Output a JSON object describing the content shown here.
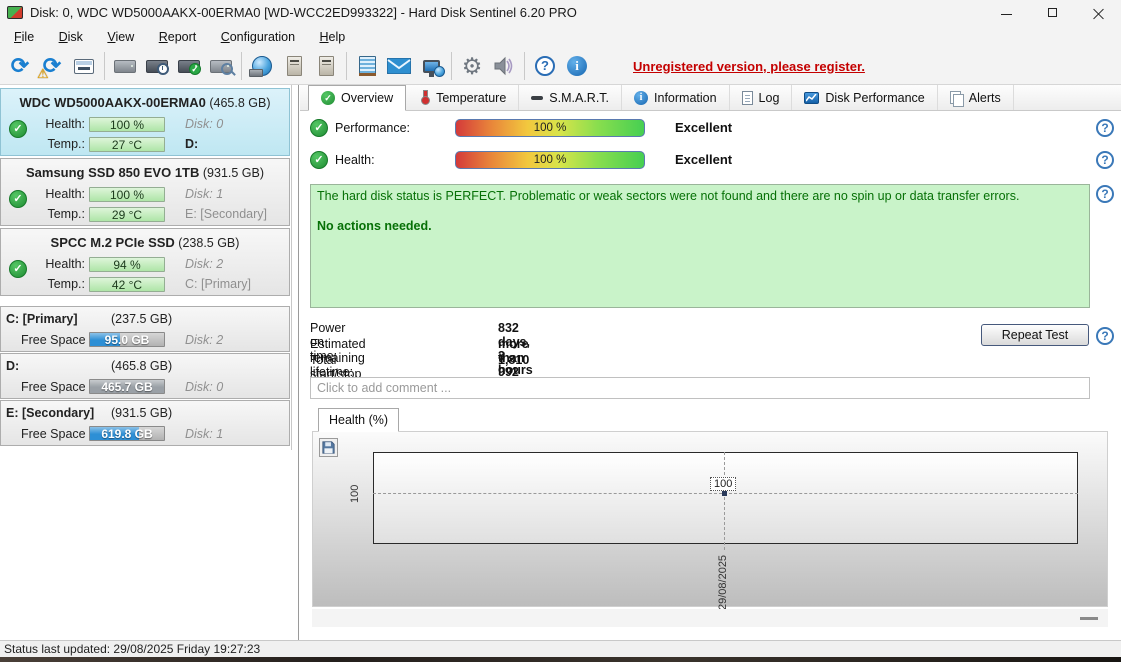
{
  "window": {
    "title": "Disk: 0, WDC WD5000AAKX-00ERMA0 [WD-WCC2ED993322]  -  Hard Disk Sentinel 6.20 PRO"
  },
  "menu": {
    "items": [
      "File",
      "Disk",
      "View",
      "Report",
      "Configuration",
      "Help"
    ]
  },
  "toolbar": {
    "register_notice": "Unregistered version, please register.",
    "icon_names": [
      "refresh",
      "refresh-warning",
      "report",
      "disk-detect",
      "disk-clock",
      "disk-test",
      "disk-search",
      "network-drive",
      "disk-remove",
      "disk-insert",
      "notepad-report",
      "email",
      "network-status",
      "settings",
      "sounds",
      "help",
      "information"
    ]
  },
  "icons": {
    "check": "✓",
    "refresh": "⟳",
    "warning": "⚠",
    "gear": "⚙",
    "help": "?",
    "info": "i"
  },
  "sidebar": {
    "disks": [
      {
        "name": "WDC WD5000AAKX-00ERMA0",
        "size": "(465.8 GB)",
        "health_label": "Health:",
        "health": "100 %",
        "disk_label": "Disk: 0",
        "temp_label": "Temp.:",
        "temp": "27 °C",
        "drive": "D:"
      },
      {
        "name": "Samsung SSD 850 EVO 1TB",
        "size": "(931.5 GB)",
        "health_label": "Health:",
        "health": "100 %",
        "disk_label": "Disk: 1",
        "temp_label": "Temp.:",
        "temp": "29 °C",
        "drive": "E: [Secondary]"
      },
      {
        "name": "SPCC M.2 PCIe SSD",
        "size": "(238.5 GB)",
        "health_label": "Health:",
        "health": "94 %",
        "disk_label": "Disk: 2",
        "temp_label": "Temp.:",
        "temp": "42 °C",
        "drive": "C: [Primary]"
      }
    ],
    "partitions": [
      {
        "name": "C: [Primary]",
        "size": "(237.5 GB)",
        "free_label": "Free Space",
        "free": "95.0 GB",
        "free_pct": 40,
        "fill_color": "#2d8fd5",
        "disk_label": "Disk: 2"
      },
      {
        "name": "D:",
        "size": "(465.8 GB)",
        "free_label": "Free Space",
        "free": "465.7 GB",
        "free_pct": 100,
        "fill_color": "#9aa0a6",
        "disk_label": "Disk: 0"
      },
      {
        "name": "E: [Secondary]",
        "size": "(931.5 GB)",
        "free_label": "Free Space",
        "free": "619.8 GB",
        "free_pct": 66,
        "fill_color": "#2d8fd5",
        "disk_label": "Disk: 1"
      }
    ]
  },
  "tabs": {
    "items": [
      {
        "label": "Overview"
      },
      {
        "label": "Temperature"
      },
      {
        "label": "S.M.A.R.T."
      },
      {
        "label": "Information"
      },
      {
        "label": "Log"
      },
      {
        "label": "Disk Performance"
      },
      {
        "label": "Alerts"
      }
    ]
  },
  "overview": {
    "performance": {
      "label": "Performance:",
      "value": "100 %",
      "rating": "Excellent"
    },
    "health": {
      "label": "Health:",
      "value": "100 %",
      "rating": "Excellent"
    },
    "status_text": "The hard disk status is PERFECT. Problematic or weak sectors were not found and there are no spin up or data transfer errors.",
    "status_note": "No actions needed.",
    "stats": [
      {
        "label": "Power on time:",
        "value": "832 days, 3 hours"
      },
      {
        "label": "Estimated remaining lifetime:",
        "value": "more than 992 days"
      },
      {
        "label": "Total start/stop count:",
        "value": "1,810"
      }
    ],
    "repeat_test_label": "Repeat Test",
    "comment_placeholder": "Click to add comment ..."
  },
  "chart": {
    "tab_label": "Health (%)",
    "y_tick": "100",
    "point_label": "100",
    "x_tick": "29/08/2025"
  },
  "chart_data": {
    "type": "line",
    "title": "Health (%)",
    "x": [
      "29/08/2025"
    ],
    "series": [
      {
        "name": "Health",
        "values": [
          100
        ]
      }
    ],
    "y_ticks": [
      100
    ],
    "point_labels": [
      "100"
    ],
    "grid": "dashed-crosshair",
    "legend_position": "none"
  },
  "status_bar": {
    "text": "Status last updated: 29/08/2025 Friday 19:27:23"
  }
}
